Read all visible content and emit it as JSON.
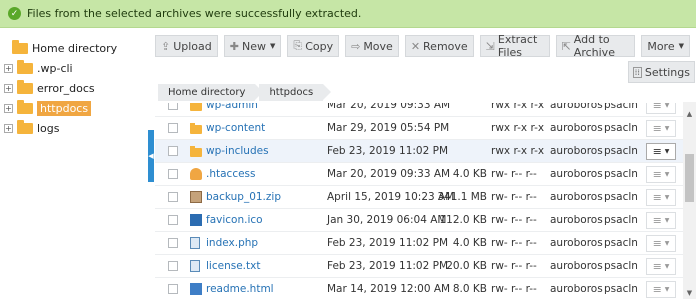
{
  "banner": {
    "message": "Files from the selected archives were successfully extracted."
  },
  "tree": {
    "root_label": "Home directory",
    "items": [
      {
        "label": ".wp-cli",
        "selected": false
      },
      {
        "label": "error_docs",
        "selected": false
      },
      {
        "label": "httpdocs",
        "selected": true
      },
      {
        "label": "logs",
        "selected": false
      }
    ]
  },
  "toolbar": {
    "upload": "Upload",
    "new": "New",
    "copy": "Copy",
    "move": "Move",
    "remove": "Remove",
    "extract": "Extract Files",
    "add_archive": "Add to Archive",
    "more": "More",
    "settings": "Settings"
  },
  "breadcrumb": [
    "Home directory",
    "httpdocs"
  ],
  "files": [
    {
      "name": "wp-admin",
      "type": "folder",
      "date": "Mar 20, 2019 09:33 AM",
      "size": "",
      "perm": "rwx r-x r-x",
      "user": "auroboros",
      "group": "psacln"
    },
    {
      "name": "wp-content",
      "type": "folder",
      "date": "Mar 29, 2019 05:54 PM",
      "size": "",
      "perm": "rwx r-x r-x",
      "user": "auroboros",
      "group": "psacln"
    },
    {
      "name": "wp-includes",
      "type": "folder",
      "date": "Feb 23, 2019 11:02 PM",
      "size": "",
      "perm": "rwx r-x r-x",
      "user": "auroboros",
      "group": "psacln"
    },
    {
      "name": ".htaccess",
      "type": "person",
      "date": "Mar 20, 2019 09:33 AM",
      "size": "4.0 KB",
      "perm": "rw- r-- r--",
      "user": "auroboros",
      "group": "psacln"
    },
    {
      "name": "backup_01.zip",
      "type": "zip",
      "date": "April 15, 2019 10:23 AM",
      "size": "341.1 MB",
      "perm": "rw- r-- r--",
      "user": "auroboros",
      "group": "psacln"
    },
    {
      "name": "favicon.ico",
      "type": "ico",
      "date": "Jan 30, 2019 06:04 AM",
      "size": "112.0 KB",
      "perm": "rw- r-- r--",
      "user": "auroboros",
      "group": "psacln"
    },
    {
      "name": "index.php",
      "type": "doc",
      "date": "Feb 23, 2019 11:02 PM",
      "size": "4.0 KB",
      "perm": "rw- r-- r--",
      "user": "auroboros",
      "group": "psacln"
    },
    {
      "name": "license.txt",
      "type": "doc",
      "date": "Feb 23, 2019 11:02 PM",
      "size": "20.0 KB",
      "perm": "rw- r-- r--",
      "user": "auroboros",
      "group": "psacln"
    },
    {
      "name": "readme.html",
      "type": "html",
      "date": "Mar 14, 2019 12:00 AM",
      "size": "8.0 KB",
      "perm": "rw- r-- r--",
      "user": "auroboros",
      "group": "psacln"
    }
  ]
}
